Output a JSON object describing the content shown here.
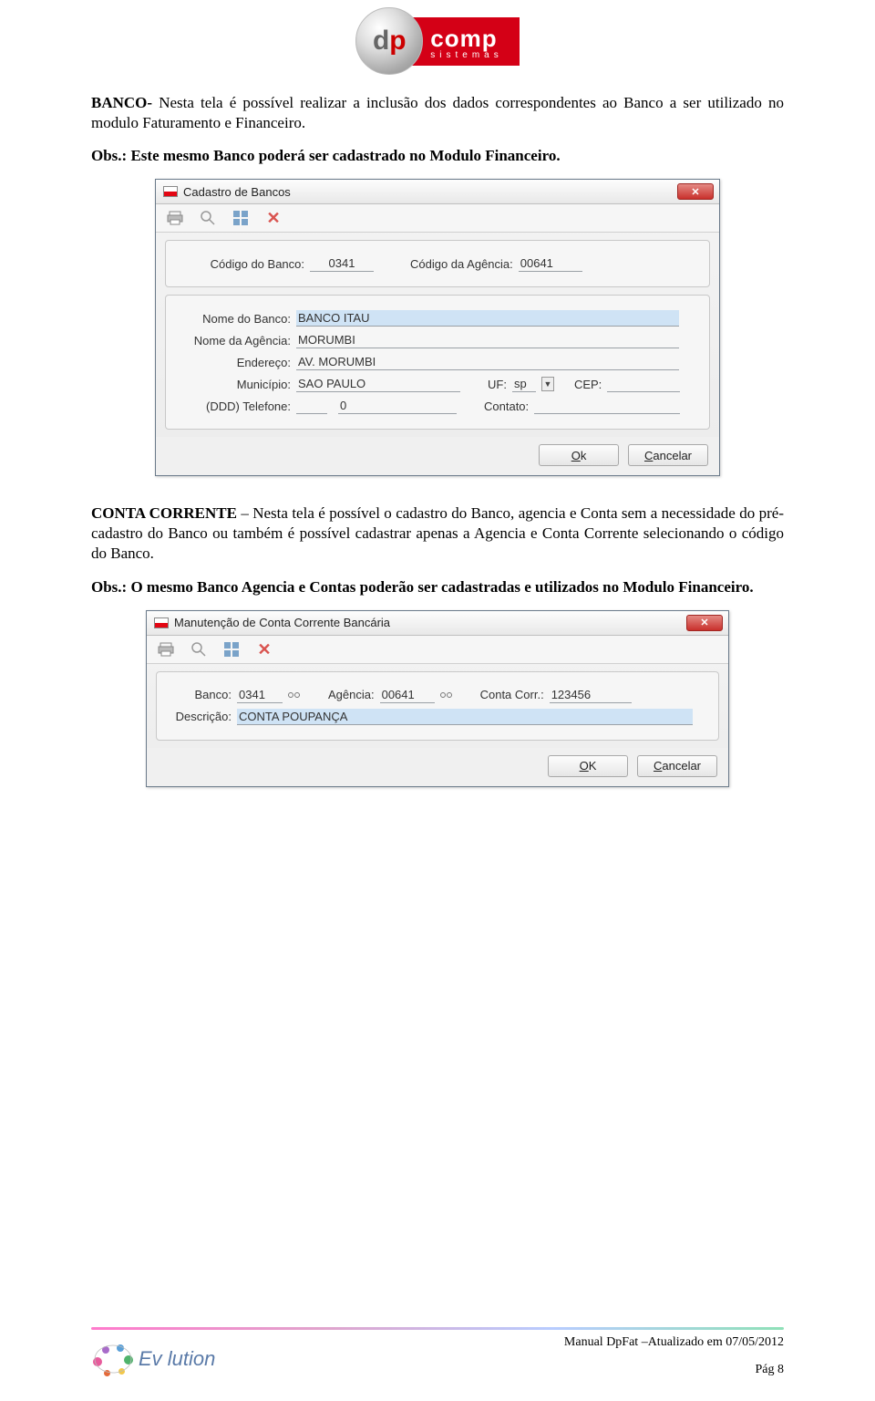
{
  "logo": {
    "dp": "dp",
    "comp": "comp",
    "sistemas": "sistemas"
  },
  "para1_bold": "BANCO-",
  "para1_rest": " Nesta tela é possível realizar a inclusão dos dados correspondentes ao Banco a ser utilizado no modulo Faturamento e Financeiro.",
  "para2": "Obs.: Este mesmo Banco poderá ser cadastrado no Modulo Financeiro.",
  "dlg1": {
    "title": "Cadastro de Bancos",
    "lbl_codigo_banco": "Código do Banco:",
    "val_codigo_banco": "0341",
    "lbl_codigo_agencia": "Código da Agência:",
    "val_codigo_agencia": "00641",
    "lbl_nome_banco": "Nome do Banco:",
    "val_nome_banco": "BANCO ITAU",
    "lbl_nome_agencia": "Nome da Agência:",
    "val_nome_agencia": "MORUMBI",
    "lbl_endereco": "Endereço:",
    "val_endereco": "AV. MORUMBI",
    "lbl_municipio": "Município:",
    "val_municipio": "SAO PAULO",
    "lbl_uf": "UF:",
    "val_uf": "sp",
    "lbl_cep": "CEP:",
    "val_cep": "",
    "lbl_ddd": "(DDD) Telefone:",
    "val_ddd": "",
    "val_tel": "0",
    "lbl_contato": "Contato:",
    "val_contato": "",
    "ok": "Ok",
    "cancel": "Cancelar"
  },
  "para3_bold": "CONTA CORRENTE",
  "para3_rest": " – Nesta tela é possível o cadastro do Banco, agencia e Conta sem a necessidade do pré-cadastro do Banco ou também é possível cadastrar apenas a Agencia e Conta Corrente selecionando o código do Banco.",
  "para4": "Obs.: O mesmo Banco Agencia e Contas poderão ser cadastradas e utilizados no Modulo Financeiro.",
  "dlg2": {
    "title": "Manutenção de Conta Corrente Bancária",
    "lbl_banco": "Banco:",
    "val_banco": "0341",
    "lbl_agencia": "Agência:",
    "val_agencia": "00641",
    "lbl_conta": "Conta Corr.:",
    "val_conta": "123456",
    "lbl_desc": "Descrição:",
    "val_desc": "CONTA POUPANÇA",
    "ok": "OK",
    "cancel": "Cancelar"
  },
  "footer": {
    "evolution": "Ev    lution",
    "manual": "Manual DpFat –Atualizado em 07/05/2012",
    "page": "Pág 8"
  }
}
